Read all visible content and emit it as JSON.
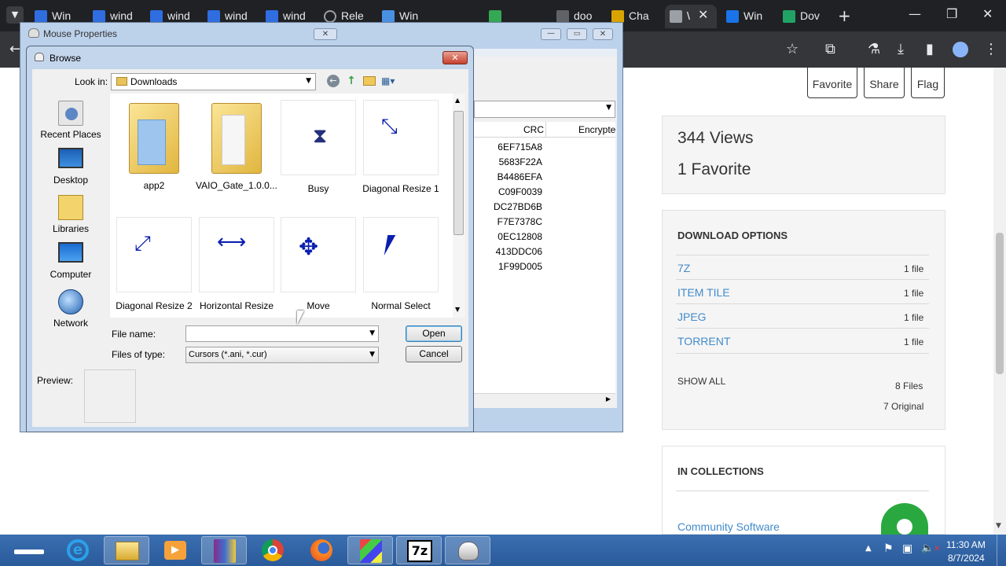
{
  "browser": {
    "tabs": [
      {
        "label": "Win",
        "color": "#2f6de1"
      },
      {
        "label": "wind",
        "color": "#2f6de1"
      },
      {
        "label": "wind",
        "color": "#2f6de1"
      },
      {
        "label": "wind",
        "color": "#2f6de1"
      },
      {
        "label": "wind",
        "color": "#2f6de1"
      },
      {
        "label": "Rele",
        "color": "#9aa0a6"
      },
      {
        "label": "Win",
        "color": "#4a90e2"
      },
      {
        "label": "",
        "color": "#34a853"
      },
      {
        "label": "doo",
        "color": "#9aa0a6"
      },
      {
        "label": "Cha",
        "color": "#d9a400"
      },
      {
        "label": "\\",
        "color": "#9aa0a6"
      },
      {
        "label": "Win",
        "color": "#1a73e8"
      },
      {
        "label": "Dov",
        "color": "#21a366"
      }
    ]
  },
  "page": {
    "actions": {
      "favorite": "Favorite",
      "share": "Share",
      "flag": "Flag"
    },
    "stats": {
      "views": "344 Views",
      "favorites": "1 Favorite"
    },
    "download": {
      "heading": "DOWNLOAD OPTIONS",
      "options": [
        {
          "name": "7Z",
          "count": "1 file"
        },
        {
          "name": "ITEM TILE",
          "count": "1 file"
        },
        {
          "name": "JPEG",
          "count": "1 file"
        },
        {
          "name": "TORRENT",
          "count": "1 file"
        }
      ],
      "show_all": "SHOW ALL",
      "files": "8 Files",
      "original": "7 Original"
    },
    "collections": {
      "heading": "IN COLLECTIONS",
      "item": "Community Software"
    }
  },
  "mouse_window": {
    "title": "Mouse Properties",
    "columns": {
      "crc": "CRC",
      "encrypted": "Encrypte"
    },
    "crc_values": [
      "6EF715A8",
      "5683F22A",
      "B4486EFA",
      "C09F0039",
      "DC27BD6B",
      "F7E7378C",
      "0EC12808",
      "413DDC06",
      "1F99D005"
    ]
  },
  "browse": {
    "title": "Browse",
    "look_in_label": "Look in:",
    "look_in_value": "Downloads",
    "places": [
      "Recent Places",
      "Desktop",
      "Libraries",
      "Computer",
      "Network"
    ],
    "files": [
      "app2",
      "VAIO_Gate_1.0.0....",
      "Busy",
      "Diagonal Resize 1",
      "Diagonal Resize 2",
      "Horizontal Resize",
      "Move",
      "Normal Select"
    ],
    "file_name_label": "File name:",
    "file_name_value": "",
    "files_of_type_label": "Files of type:",
    "files_of_type_value": "Cursors (*.ani, *.cur)",
    "open_label": "Open",
    "cancel_label": "Cancel",
    "preview_label": "Preview:"
  },
  "taskbar": {
    "time": "11:30 AM",
    "date": "8/7/2024",
    "apps": [
      "ie-icon",
      "explorer-icon",
      "media-player-icon",
      "winrar-icon",
      "chrome-icon",
      "firefox-icon",
      "app-icon",
      "7zip-icon",
      "mouse-icon"
    ],
    "app_7z_label": "7z"
  }
}
